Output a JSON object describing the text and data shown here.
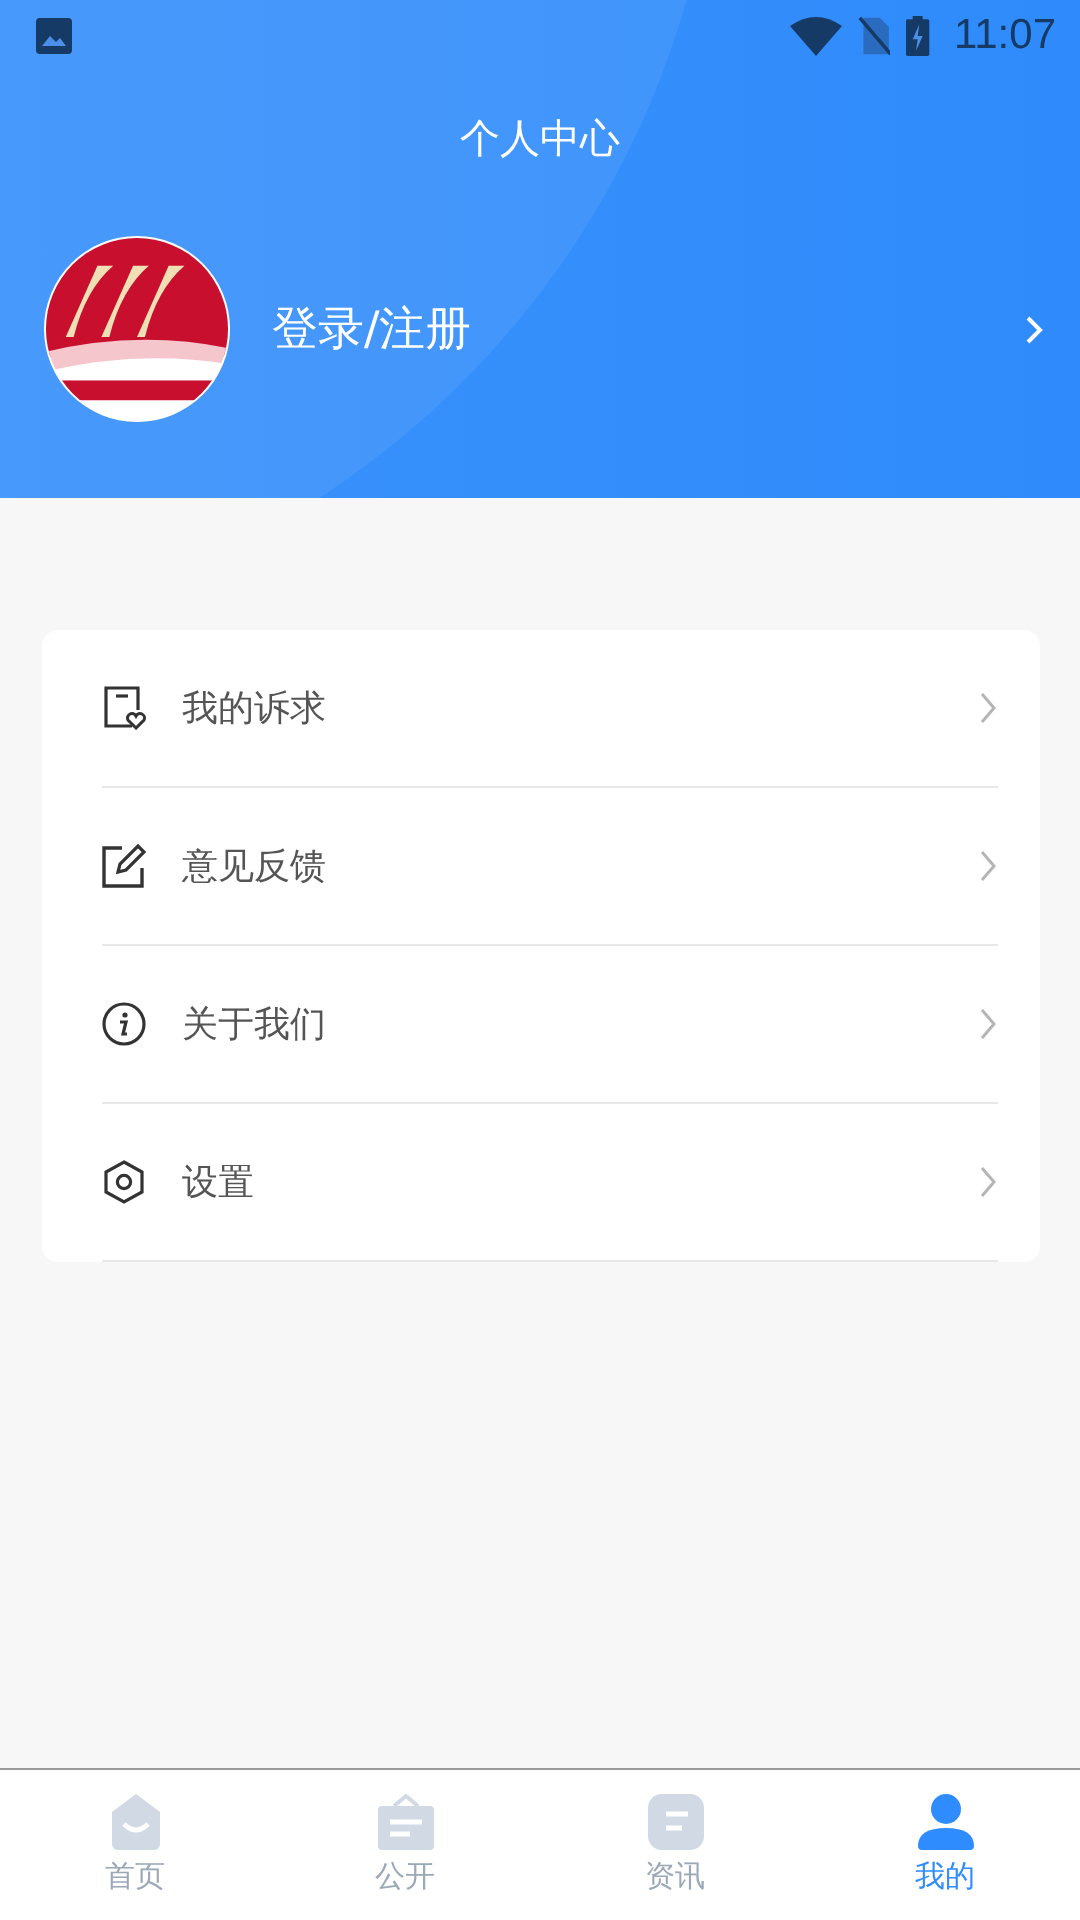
{
  "status_bar": {
    "time": "11:07"
  },
  "header": {
    "title": "个人中心",
    "login_label": "登录/注册"
  },
  "menu": [
    {
      "kind": "requests",
      "label": "我的诉求"
    },
    {
      "kind": "feedback",
      "label": "意见反馈"
    },
    {
      "kind": "about",
      "label": "关于我们"
    },
    {
      "kind": "settings",
      "label": "设置"
    }
  ],
  "tabs": [
    {
      "kind": "home",
      "label": "首页",
      "selected": false
    },
    {
      "kind": "public",
      "label": "公开",
      "selected": false
    },
    {
      "kind": "news",
      "label": "资讯",
      "selected": false
    },
    {
      "kind": "profile",
      "label": "我的",
      "selected": true
    }
  ]
}
